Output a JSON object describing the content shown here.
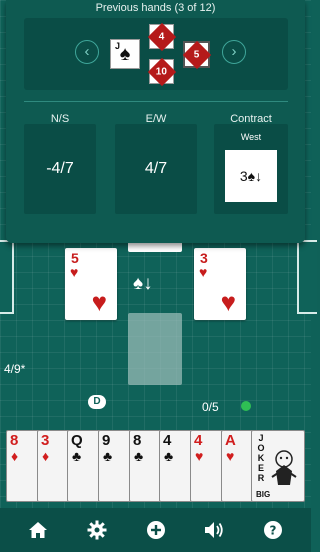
{
  "history": {
    "title": "Previous hands (3 of 12)",
    "prev_label": "‹",
    "next_label": "›",
    "trick_cards": [
      {
        "rank": "J",
        "suit": "♠",
        "color": "#111111"
      },
      {
        "rank": "4",
        "suit": "♦",
        "color": "#b51a1a"
      },
      {
        "rank": "10",
        "suit": "♦",
        "color": "#b51a1a"
      },
      {
        "rank": "5",
        "suit": "♦",
        "color": "#b51a1a"
      }
    ]
  },
  "scores": {
    "ns_label": "N/S",
    "ns_value": "-4/7",
    "ew_label": "E/W",
    "ew_value": "4/7",
    "contract_label": "Contract",
    "contract_seat": "West",
    "contract_bid": "3♠↓"
  },
  "table": {
    "played_cards": [
      {
        "rank": "5",
        "suit": "♥"
      },
      {
        "rank": "3",
        "suit": "♥"
      }
    ],
    "trump_indicator": "♠↓",
    "left_score": "4/9*",
    "dealer_marker": "D",
    "tricks_count": "0/5"
  },
  "hand": [
    {
      "rank": "8",
      "suit": "♦",
      "color": "red"
    },
    {
      "rank": "3",
      "suit": "♦",
      "color": "red"
    },
    {
      "rank": "Q",
      "suit": "♣",
      "color": "blk"
    },
    {
      "rank": "9",
      "suit": "♣",
      "color": "blk"
    },
    {
      "rank": "8",
      "suit": "♣",
      "color": "blk"
    },
    {
      "rank": "4",
      "suit": "♣",
      "color": "blk"
    },
    {
      "rank": "4",
      "suit": "♥",
      "color": "red"
    },
    {
      "rank": "A",
      "suit": "♥",
      "color": "red"
    },
    {
      "rank": "JOKER",
      "suit": "",
      "color": "blk",
      "sub": "BIG"
    }
  ],
  "toolbar": {
    "icons": [
      "home-icon",
      "settings-icon",
      "add-icon",
      "sound-icon",
      "help-icon"
    ]
  },
  "colors": {
    "felt": "#0f6259",
    "panel": "#0e5a51",
    "accent": "#3fa69a",
    "red_suit": "#c71d1d"
  }
}
